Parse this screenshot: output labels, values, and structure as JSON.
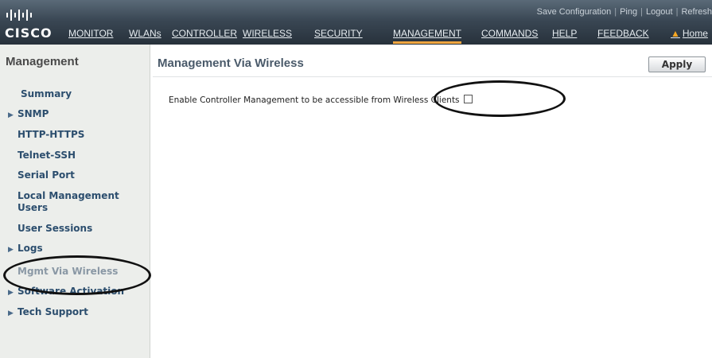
{
  "brand": {
    "name": "CISCO"
  },
  "utility_links": [
    "Save Configuration",
    "Ping",
    "Logout",
    "Refresh"
  ],
  "nav": {
    "items": [
      "MONITOR",
      "WLANs",
      "CONTROLLER",
      "WIRELESS",
      "SECURITY",
      "MANAGEMENT",
      "COMMANDS",
      "HELP",
      "FEEDBACK",
      "Home"
    ],
    "active": "MANAGEMENT"
  },
  "sidebar": {
    "title": "Management",
    "items": [
      {
        "label": "Summary",
        "expandable": false
      },
      {
        "label": "SNMP",
        "expandable": true
      },
      {
        "label": "HTTP-HTTPS",
        "expandable": false
      },
      {
        "label": "Telnet-SSH",
        "expandable": false
      },
      {
        "label": "Serial Port",
        "expandable": false
      },
      {
        "label": "Local Management Users",
        "expandable": false
      },
      {
        "label": "User Sessions",
        "expandable": false
      },
      {
        "label": "Logs",
        "expandable": true
      },
      {
        "label": "Mgmt Via Wireless",
        "expandable": false,
        "active": true
      },
      {
        "label": "Software Activation",
        "expandable": true
      },
      {
        "label": "Tech Support",
        "expandable": true
      }
    ]
  },
  "main": {
    "title": "Management Via Wireless",
    "apply_label": "Apply",
    "setting_label": "Enable Controller Management to be accessible from Wireless Clients",
    "setting_checked": false
  },
  "colors": {
    "topbar": "#2f3a45",
    "active_tab_underline": "#f0a640",
    "sidebar_bg": "#eceeeb",
    "sidebar_link": "#2c4e6e",
    "sidebar_active": "#8a98a5"
  },
  "icons": {
    "home": "home-icon",
    "expand": "triangle-right-icon",
    "logo": "cisco-bars-logo"
  }
}
